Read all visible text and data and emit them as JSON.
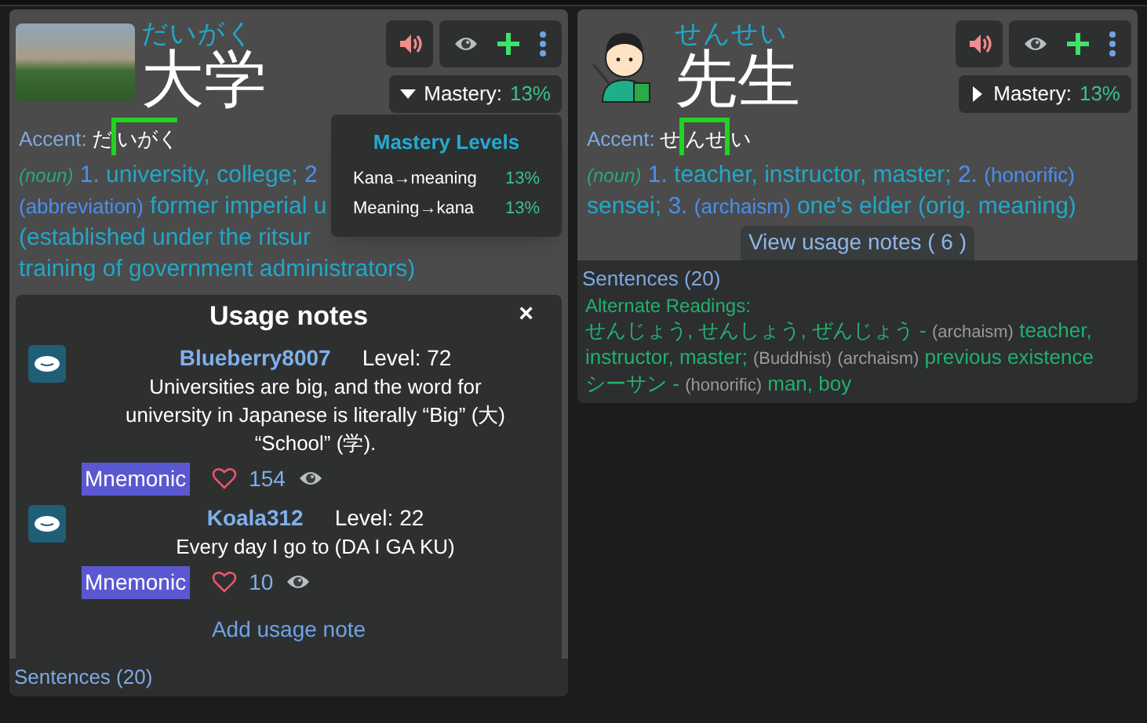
{
  "cards": [
    {
      "picture": {
        "kind": "photo"
      },
      "reading": "だいがく",
      "word": "大学",
      "mastery": {
        "label": "Mastery:",
        "value": "13%",
        "expanded": true
      },
      "mastery_popup": {
        "title": "Mastery Levels",
        "rows": [
          {
            "label": "Kana→meaning",
            "value": "13%"
          },
          {
            "label": "Meaning→kana",
            "value": "13%"
          }
        ]
      },
      "accent": {
        "label": "Accent:",
        "segments": [
          {
            "text": "だ",
            "high": false
          },
          {
            "text": "いがく",
            "high": true
          }
        ]
      },
      "definition_lines": [
        [
          {
            "kind": "pos",
            "text": "(noun)"
          },
          {
            "kind": "num",
            "text": "1."
          },
          {
            "kind": "text",
            "text": "university, college;"
          },
          {
            "kind": "num",
            "text": "2"
          }
        ],
        [
          {
            "kind": "tag",
            "text": "(abbreviation)"
          },
          {
            "kind": "text",
            "text": "former imperial u"
          }
        ],
        [
          {
            "kind": "text",
            "text": "(established under the ritsur"
          }
        ],
        [
          {
            "kind": "text",
            "text": "training of government administrators)"
          }
        ]
      ],
      "usage_notes": {
        "title": "Usage notes",
        "close": "×",
        "notes": [
          {
            "user": "Blueberry8007",
            "level": "Level: 72",
            "text": "Universities are big, and the word for university in Japanese is literally “Big” (大) “School” (学).",
            "tag": "Mnemonic",
            "likes": "154"
          },
          {
            "user": "Koala312",
            "level": "Level: 22",
            "text": "Every day I go to (DA I GA KU)",
            "tag": "Mnemonic",
            "likes": "10"
          }
        ],
        "add": "Add usage note"
      },
      "sentences": "Sentences (20)"
    },
    {
      "picture": {
        "kind": "illustration"
      },
      "reading": "せんせい",
      "word": "先生",
      "mastery": {
        "label": "Mastery:",
        "value": "13%",
        "expanded": false
      },
      "accent": {
        "label": "Accent:",
        "segments": [
          {
            "text": "せ",
            "high": false
          },
          {
            "text": "んせ",
            "high": true
          },
          {
            "text": "い",
            "high": false
          }
        ]
      },
      "definition_lines": [
        [
          {
            "kind": "pos",
            "text": "(noun)"
          },
          {
            "kind": "num",
            "text": "1."
          },
          {
            "kind": "text",
            "text": "teacher, instructor, master;"
          },
          {
            "kind": "num",
            "text": "2."
          },
          {
            "kind": "tag",
            "text": "(honorific)"
          }
        ],
        [
          {
            "kind": "text",
            "text": "sensei;"
          },
          {
            "kind": "num",
            "text": "3."
          },
          {
            "kind": "tag",
            "text": "(archaism)"
          },
          {
            "kind": "text",
            "text": "one's elder (orig. meaning)"
          }
        ]
      ],
      "view_notes": "View usage notes ( 6 )",
      "sentences": "Sentences (20)",
      "alternate": {
        "title": "Alternate Readings:",
        "lines": [
          [
            {
              "kind": "reading",
              "text": "せんじょう, せんしょう, ぜんじょう -"
            },
            {
              "kind": "tag",
              "text": "(archaism)"
            },
            {
              "kind": "meaning",
              "text": "teacher,"
            }
          ],
          [
            {
              "kind": "meaning",
              "text": "instructor, master;"
            },
            {
              "kind": "tag",
              "text": "(Buddhist)"
            },
            {
              "kind": "tag",
              "text": "(archaism)"
            },
            {
              "kind": "meaning",
              "text": "previous existence"
            }
          ],
          [
            {
              "kind": "reading",
              "text": "シーサン -"
            },
            {
              "kind": "tag",
              "text": "(honorific)"
            },
            {
              "kind": "meaning",
              "text": "man, boy"
            }
          ]
        ]
      }
    }
  ]
}
